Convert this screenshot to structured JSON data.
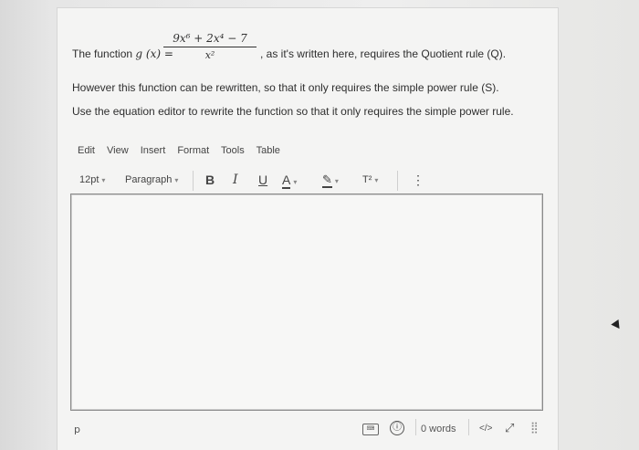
{
  "question": {
    "line1_prefix": "The function",
    "func_lhs": "g (x) =",
    "numerator": "9x⁶ + 2x⁴ − 7",
    "denominator": "x²",
    "line1_suffix": ", as it's written here, requires the Quotient rule (Q).",
    "line2": "However this function can be rewritten, so that it only requires the simple power rule (S).",
    "line3": "Use the equation editor to rewrite the function so that it only requires the simple power rule."
  },
  "editor": {
    "menu": [
      "Edit",
      "View",
      "Insert",
      "Format",
      "Tools",
      "Table"
    ],
    "font_size": "12pt",
    "block_format": "Paragraph",
    "bold": "B",
    "italic": "I",
    "underline": "U",
    "font_color": "A",
    "superscript": "T²",
    "more": "⋮",
    "content": "",
    "status_path": "p",
    "word_count": "0 words",
    "code_view": "</>",
    "accent_color": "#1a73b8"
  }
}
